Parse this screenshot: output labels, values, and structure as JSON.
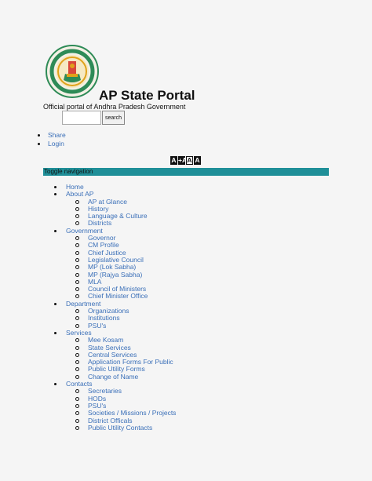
{
  "header": {
    "title": "AP State Portal",
    "tagline": "Official portal of Andhra Pradesh Government",
    "search_value": "",
    "search_button": "search"
  },
  "top_links": [
    {
      "label": "Share"
    },
    {
      "label": "Login"
    }
  ],
  "font_controls": [
    "A",
    "+A",
    "A",
    "A"
  ],
  "navbar": {
    "toggle_label": "Toggle navigation"
  },
  "menu": [
    {
      "label": "Home",
      "children": []
    },
    {
      "label": "About AP",
      "children": [
        "AP at Glance",
        "History",
        "Language & Culture",
        "Districts"
      ]
    },
    {
      "label": "Government",
      "children": [
        "Governor",
        "CM Profile",
        "Chief Justice",
        "Legislative Council",
        "MP (Lok Sabha)",
        "MP (Rajya Sabha)",
        "MLA",
        "Council of Ministers",
        "Chief Minister Office"
      ]
    },
    {
      "label": "Department",
      "children": [
        "Organizations",
        "Institutions",
        "PSU's"
      ]
    },
    {
      "label": "Services",
      "children": [
        "Mee Kosam",
        "State Services",
        "Central Services",
        "Application Forms For Public",
        "Public Utility Forms",
        "Change of Name"
      ]
    },
    {
      "label": "Contacts",
      "children": [
        "Secretaries",
        "HODs",
        "PSU's",
        "Societies / Missions / Projects",
        "District Officals",
        "Public Utility Contacts"
      ]
    }
  ],
  "colors": {
    "link": "#3a6fb8",
    "navbar": "#1f8f98",
    "emblem_green": "#2e8b57",
    "emblem_gold": "#e0a21b"
  },
  "icons": {
    "logo": "andhra-pradesh-emblem-icon"
  }
}
